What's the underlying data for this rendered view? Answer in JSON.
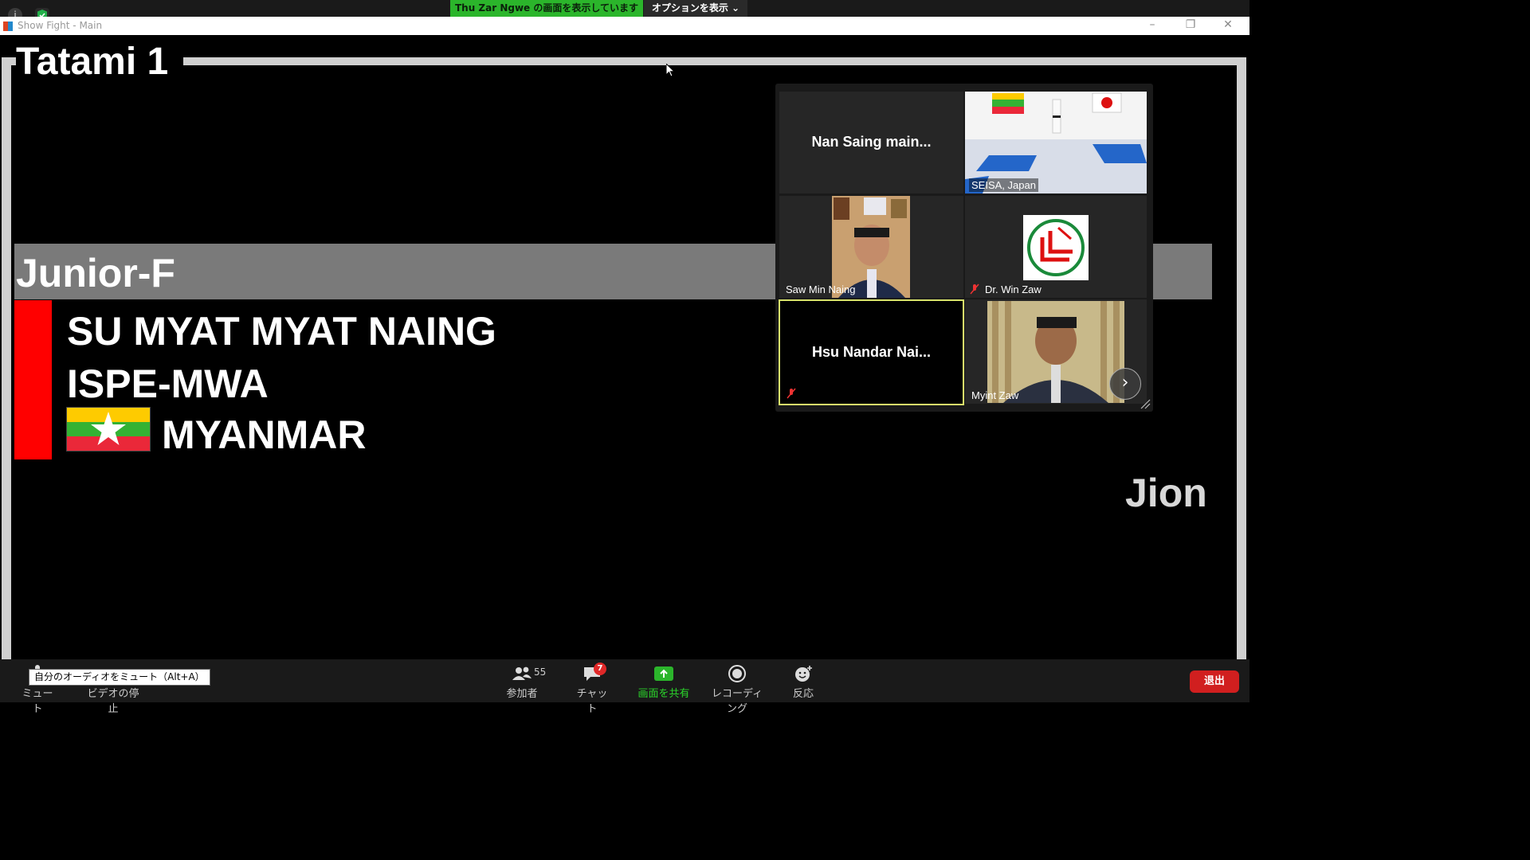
{
  "zoom_top": {
    "share_banner": "Thu Zar Ngwe の画面を表示しています",
    "options_label": "オプションを表示 ⌄",
    "info_icon": "info-icon",
    "security_icon": "shield-icon"
  },
  "window": {
    "title": "Show Fight - Main"
  },
  "scoreboard": {
    "tatami": "Tatami 1",
    "division": "Junior-F",
    "athlete_name": "SU MYAT MYAT NAING",
    "team": "ISPE-MWA",
    "country": "MYANMAR",
    "kata": "Jion",
    "corner_color": "#ff0000"
  },
  "gallery": {
    "tiles": [
      {
        "name": "Nan Saing main...",
        "label": ""
      },
      {
        "name": "",
        "label": "SEISA, Japan"
      },
      {
        "name": "",
        "label": "Saw Min Naing"
      },
      {
        "name": "",
        "label": "Dr. Win Zaw"
      },
      {
        "name": "Hsu Nandar Nai...",
        "label": ""
      },
      {
        "name": "",
        "label": "Myint Zaw"
      }
    ]
  },
  "toolbar": {
    "mute_label": "ミュート",
    "video_label": "ビデオの停止",
    "participants_label": "参加者",
    "participants_count": "55",
    "chat_label": "チャット",
    "chat_badge": "7",
    "share_label": "画面を共有",
    "record_label": "レコーディング",
    "reactions_label": "反応",
    "leave_label": "退出",
    "tooltip": "自分のオーディオをミュート（Alt+A）"
  },
  "colors": {
    "share_green": "#2bb52b",
    "leave_red": "#d11f1f",
    "active_speaker": "#d8e36a"
  }
}
